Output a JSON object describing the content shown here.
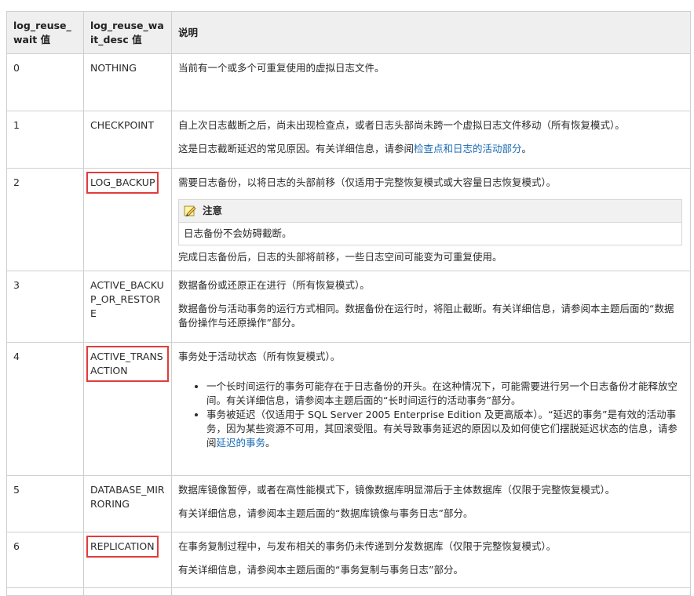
{
  "headers": {
    "value": "log_reuse_wait 值",
    "desc": "log_reuse_wait_desc 值",
    "explain": "说明"
  },
  "rows": [
    {
      "value": "0",
      "desc": "NOTHING",
      "p1": "当前有一个或多个可重复使用的虚拟日志文件。"
    },
    {
      "value": "1",
      "desc": "CHECKPOINT",
      "p1": "自上次日志截断之后，尚未出现检查点，或者日志头部尚未跨一个虚拟日志文件移动（所有恢复模式）。",
      "p2_pre": "这是日志截断延迟的常见原因。有关详细信息，请参阅",
      "p2_link": "检查点和日志的活动部分",
      "p2_post": "。"
    },
    {
      "value": "2",
      "desc": "LOG_BACKUP",
      "p1": "需要日志备份，以将日志的头部前移（仅适用于完整恢复模式或大容量日志恢复模式）。",
      "note_title": "注意",
      "note_body": "日志备份不会妨碍截断。",
      "p2": "完成日志备份后，日志的头部将前移，一些日志空间可能变为可重复使用。"
    },
    {
      "value": "3",
      "desc": "ACTIVE_BACKUP_OR_RESTORE",
      "p1": "数据备份或还原正在进行（所有恢复模式）。",
      "p2": "数据备份与活动事务的运行方式相同。数据备份在运行时，将阻止截断。有关详细信息，请参阅本主题后面的“数据备份操作与还原操作”部分。"
    },
    {
      "value": "4",
      "desc": "ACTIVE_TRANSACTION",
      "p1": "事务处于活动状态（所有恢复模式）。",
      "b1": "一个长时间运行的事务可能存在于日志备份的开头。在这种情况下，可能需要进行另一个日志备份才能释放空间。有关详细信息，请参阅本主题后面的“长时间运行的活动事务”部分。",
      "b2_pre": "事务被延迟（仅适用于 SQL Server 2005 Enterprise Edition 及更高版本）。“延迟的事务”是有效的活动事务，因为某些资源不可用，其回滚受阻。有关导致事务延迟的原因以及如何使它们摆脱延迟状态的信息，请参阅",
      "b2_link": "延迟的事务",
      "b2_post": "。"
    },
    {
      "value": "5",
      "desc": "DATABASE_MIRRORING",
      "p1": "数据库镜像暂停，或者在高性能模式下，镜像数据库明显滞后于主体数据库（仅限于完整恢复模式）。",
      "p2": "有关详细信息，请参阅本主题后面的“数据库镜像与事务日志”部分。"
    },
    {
      "value": "6",
      "desc": "REPLICATION",
      "p1": "在事务复制过程中，与发布相关的事务仍未传递到分发数据库（仅限于完整恢复模式）。",
      "p2": "有关详细信息，请参阅本主题后面的“事务复制与事务日志”部分。"
    }
  ],
  "icons": {
    "note": "note-pencil-icon"
  },
  "colors": {
    "link": "#1a6bb5",
    "highlight_box": "#e23b3b",
    "header_bg": "#efefef"
  }
}
